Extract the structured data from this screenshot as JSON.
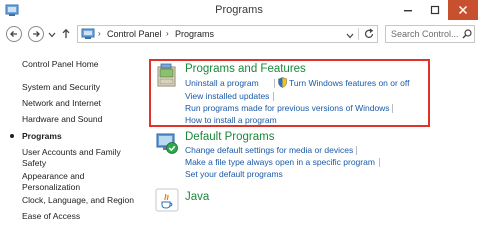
{
  "window": {
    "title": "Programs"
  },
  "address_bar": {
    "breadcrumb": [
      "Control Panel",
      "Programs"
    ],
    "separator": "›"
  },
  "search": {
    "placeholder": "Search Control..."
  },
  "sidebar": {
    "items": [
      {
        "label": "Control Panel Home",
        "current": false
      },
      {
        "label": "System and Security",
        "current": false
      },
      {
        "label": "Network and Internet",
        "current": false
      },
      {
        "label": "Hardware and Sound",
        "current": false
      },
      {
        "label": "Programs",
        "current": true
      },
      {
        "label": "User Accounts and Family Safety",
        "current": false
      },
      {
        "label": "Appearance and Personalization",
        "current": false
      },
      {
        "label": "Clock, Language, and Region",
        "current": false
      },
      {
        "label": "Ease of Access",
        "current": false
      }
    ]
  },
  "categories": [
    {
      "title": "Programs and Features",
      "icon": "programs-and-features-icon",
      "links": [
        "Uninstall a program",
        "Turn Windows features on or off",
        "View installed updates",
        "Run programs made for previous versions of Windows",
        "How to install a program"
      ],
      "highlighted": true
    },
    {
      "title": "Default Programs",
      "icon": "default-programs-icon",
      "links": [
        "Change default settings for media or devices",
        "Make a file type always open in a specific program",
        "Set your default programs"
      ],
      "highlighted": false
    },
    {
      "title": "Java",
      "icon": "java-icon",
      "links": [],
      "highlighted": false
    }
  ],
  "colors": {
    "category_title": "#1a8a3a",
    "link": "#1a5aa8",
    "highlight_border": "#e0332a",
    "close_button": "#c7502f"
  }
}
